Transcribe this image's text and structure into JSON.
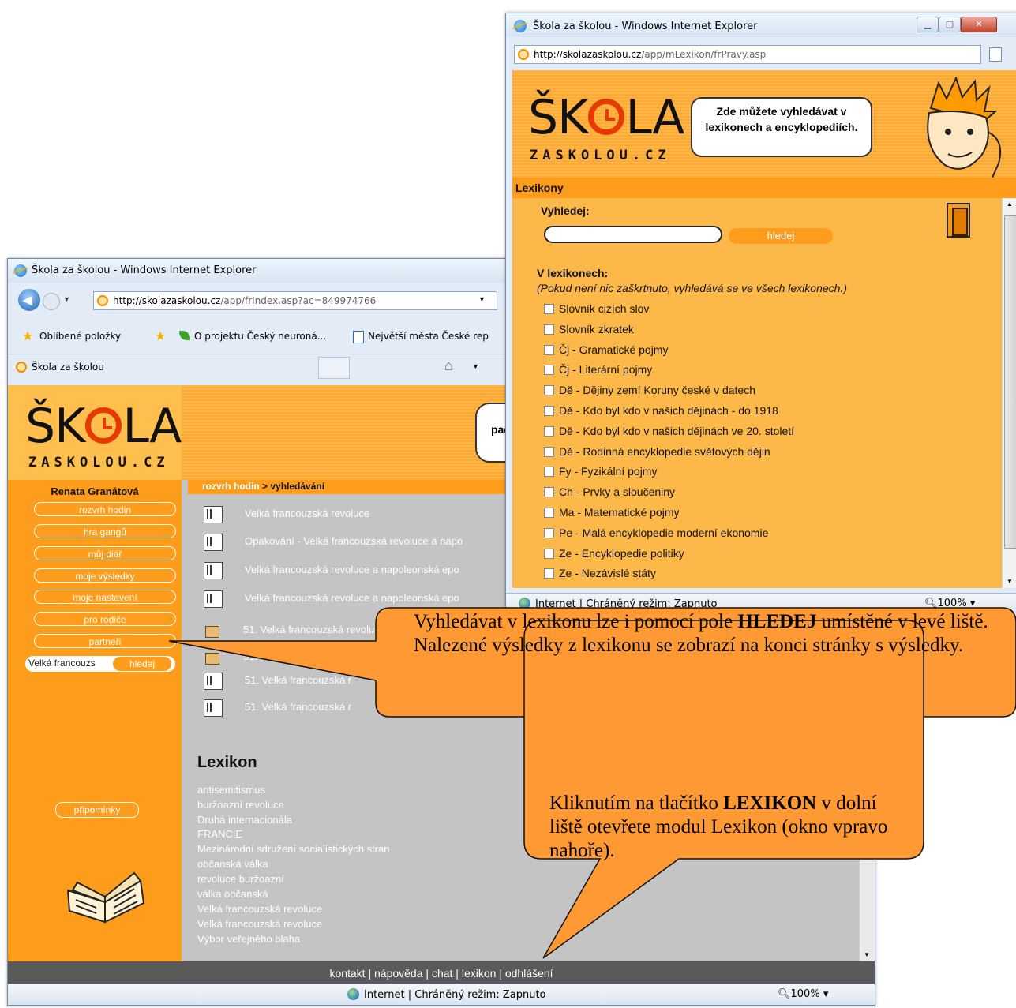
{
  "back_window": {
    "title": "Škola za školou - Windows Internet Explorer",
    "address": {
      "domain": "http://skolazaskolou.cz",
      "path": "/app/frIndex.asp?ac=849974766"
    },
    "favorites": {
      "label": "Oblíbené položky",
      "links": [
        "O projektu Český neuroná...",
        "Největší města České rep"
      ]
    },
    "tab_label": "Škola za školou",
    "site": {
      "logo_main": [
        "ŠK",
        "LA"
      ],
      "logo_sub": "ZASKOLOU.CZ",
      "speech_fragment": "pad",
      "user_name": "Renata Granátová",
      "nav": [
        "rozvrh hodin",
        "hra gangů",
        "můj diář",
        "moje výsledky",
        "moje nastavení",
        "pro rodiče",
        "partneři"
      ],
      "search_value": "Velká francouzs",
      "search_button": "hledej",
      "reminders_button": "připomínky",
      "breadcrumb_link": "rozvrh hodin",
      "breadcrumb_current": " > vyhledávání",
      "results": [
        "Velká francouzská revoluce",
        "Opakování - Velká francouzská revoluce a napo",
        "Velká francouzská revoluce a napoleonská epo",
        "Velká francouzská revoluce a napoleonská epo",
        "51. Velká francouzská revoluce",
        "51. Velká francouzská r",
        "51. Velká francouzská r",
        "51. Velká francouzská r"
      ],
      "lexikon_heading": "Lexikon",
      "lexikon_items": [
        "antisemitismus",
        "buržoazní revoluce",
        "Druhá internacionála",
        "FRANCIE",
        "Mezinárodní sdružení socialistických stran",
        "občanská válka",
        "revoluce buržoazní",
        "válka občanská",
        "Velká francouzská revoluce",
        "Velká francouzská revoluce",
        "Výbor veřejného blaha"
      ],
      "footer_links": [
        "kontakt",
        "nápověda",
        "chat",
        "lexikon",
        "odhlášení"
      ],
      "footer_sep": "|"
    },
    "status": {
      "text": "Internet | Chráněný režim: Zapnuto",
      "zoom": "100%"
    }
  },
  "front_window": {
    "title": "Škola za školou - Windows Internet Explorer",
    "address": {
      "domain": "http://skolazaskolou.cz",
      "path": "/app/mLexikon/frPravy.asp"
    },
    "speech": "Zde můžete vyhledávat v lexikonech a encyklopediích.",
    "section_title": "Lexikony",
    "search_label": "Vyhledej:",
    "search_value": "",
    "search_button": "hledej",
    "in_lexicons_label": "V lexikonech:",
    "hint": "(Pokud není nic zaškrtnuto, vyhledává se ve všech lexikonech.)",
    "lexicons": [
      "Slovník cizích slov",
      "Slovník zkratek",
      "Čj - Gramatické pojmy",
      "Čj - Literární pojmy",
      "Dě - Dějiny zemí Koruny české v datech",
      "Dě - Kdo byl kdo v našich dějinách - do 1918",
      "Dě - Kdo byl kdo v našich dějinách ve 20. století",
      "Dě - Rodinná encyklopedie světových dějin",
      "Fy - Fyzikální pojmy",
      "Ch - Prvky a sloučeniny",
      "Ma - Matematické pojmy",
      "Pe - Malá encyklopedie moderní ekonomie",
      "Ze - Encyklopedie politiky",
      "Ze - Nezávislé státy"
    ],
    "status": {
      "text": "Internet | Chráněný režim: Zapnuto",
      "zoom": "100%"
    }
  },
  "callouts": {
    "right": {
      "pre": "Vyhledávat v lexikonu lze i pomocí pole ",
      "bold": "HLEDEJ",
      "post": " umístěné v levé liště. Nalezené výsledky z lexikonu se zobrazí na konci stránky s výsledky."
    },
    "bottom": {
      "pre": "Kliknutím na tlačítko ",
      "bold": "LEXIKON",
      "post": " v dolní liště otevřete modul Lexikon (okno vpravo nahoře)."
    }
  },
  "colors": {
    "orange": "#fe9d1c",
    "light_orange": "#fdb84a",
    "gray_panel": "#c4c4c4",
    "footer_dark": "#5a5a5a",
    "callout_fill": "#ff9933"
  }
}
